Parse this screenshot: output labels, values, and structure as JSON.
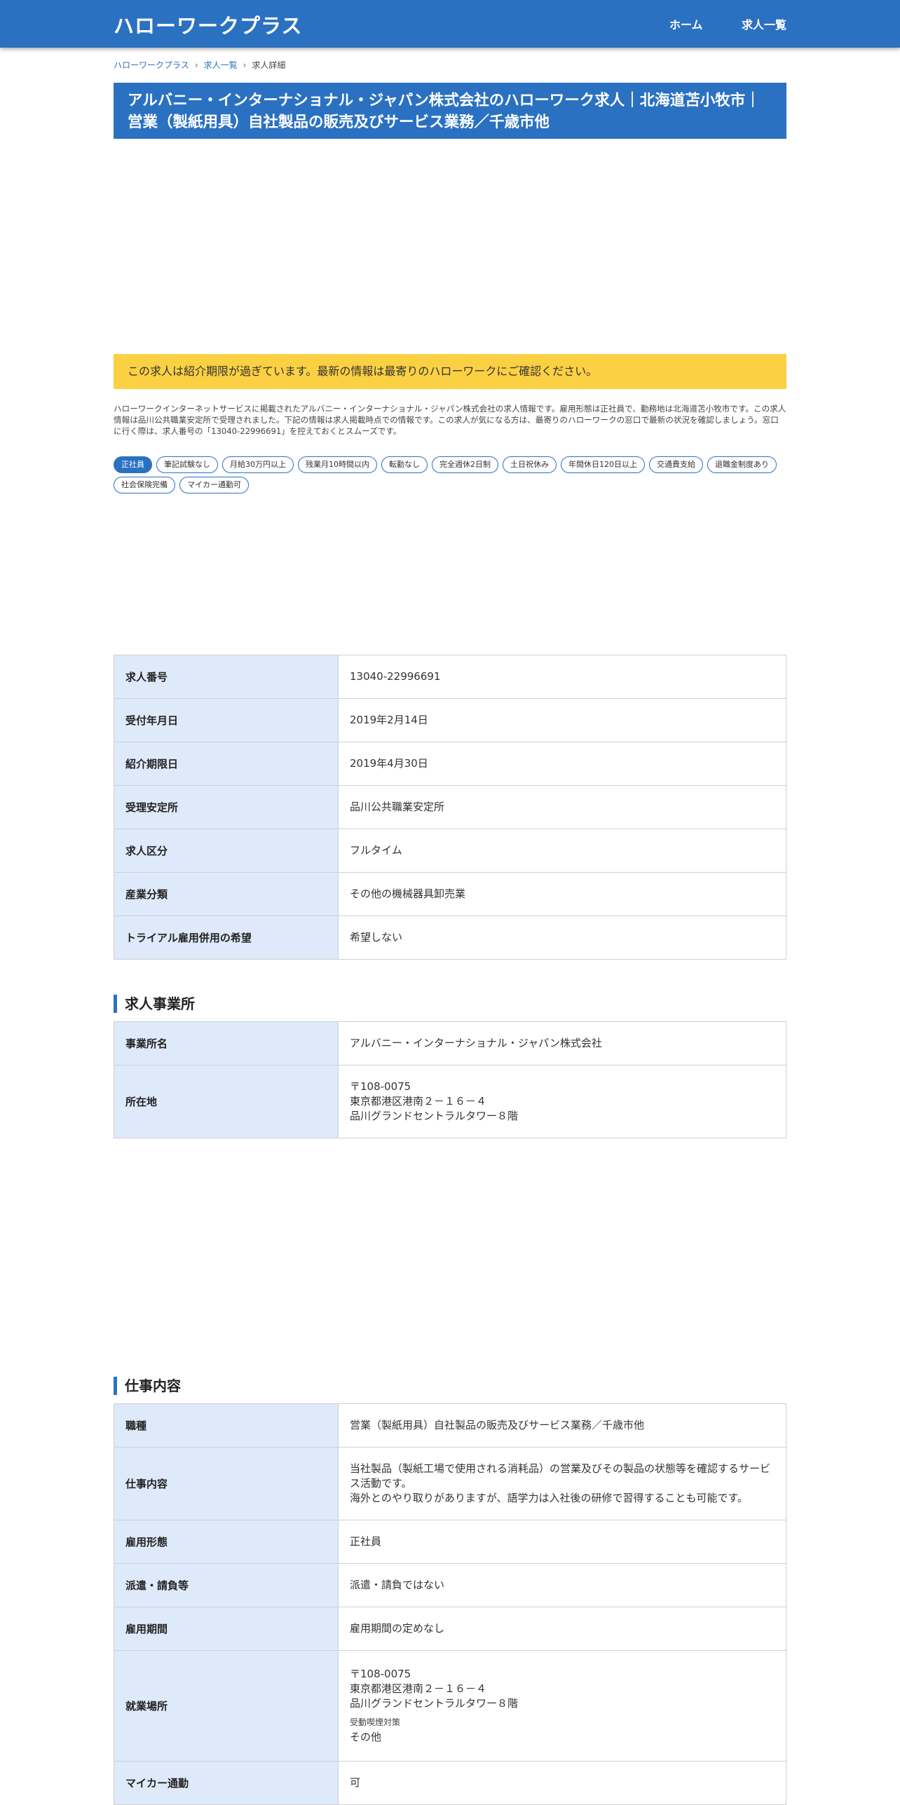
{
  "header": {
    "logo": "ハローワークプラス",
    "nav": [
      "ホーム",
      "求人一覧"
    ]
  },
  "breadcrumb": [
    "ハローワークプラス",
    "求人一覧",
    "求人詳細"
  ],
  "title": "アルバニー・インターナショナル・ジャパン株式会社のハローワーク求人｜北海道苫小牧市｜営業（製紙用具）自社製品の販売及びサービス業務／千歳市他",
  "notice": "この求人は紹介期限が過ぎています。最新の情報は最寄りのハローワークにご確認ください。",
  "description": "ハローワークインターネットサービスに掲載されたアルバニー・インターナショナル・ジャパン株式会社の求人情報です。雇用形態は正社員で、勤務地は北海道苫小牧市です。この求人情報は品川公共職業安定所で受理されました。下記の情報は求人掲載時点での情報です。この求人が気になる方は、最寄りのハローワークの窓口で最新の状況を確認しましょう。窓口に行く際は、求人番号の「13040-22996691」を控えておくとスムーズです。",
  "tags": [
    "正社員",
    "筆記試験なし",
    "月給30万円以上",
    "残業月10時間以内",
    "転勤なし",
    "完全週休2日制",
    "土日祝休み",
    "年間休日120日以上",
    "交通費支給",
    "退職金制度あり",
    "社会保険完備",
    "マイカー通勤可"
  ],
  "basic_table": [
    {
      "label": "求人番号",
      "value": "13040-22996691"
    },
    {
      "label": "受付年月日",
      "value": "2019年2月14日"
    },
    {
      "label": "紹介期限日",
      "value": "2019年4月30日"
    },
    {
      "label": "受理安定所",
      "value": "品川公共職業安定所"
    },
    {
      "label": "求人区分",
      "value": "フルタイム"
    },
    {
      "label": "産業分類",
      "value": "その他の機械器具卸売業"
    },
    {
      "label": "トライアル雇用併用の希望",
      "value": "希望しない"
    }
  ],
  "office_section": {
    "heading": "求人事業所",
    "name_label": "事業所名",
    "name": "アルバニー・インターナショナル・ジャパン株式会社",
    "address_label": "所在地",
    "address": [
      "〒108-0075",
      "東京都港区港南２－１６－４",
      "品川グランドセントラルタワー８階"
    ]
  },
  "job_section": {
    "heading": "仕事内容",
    "type_label": "職種",
    "type": "営業（製紙用具）自社製品の販売及びサービス業務／千歳市他",
    "content_label": "仕事内容",
    "content": [
      "当社製品（製紙工場で使用される消耗品）の営業及びその製品の状態等を確認するサービス活動です。",
      "海外とのやり取りがありますが、語学力は入社後の研修で習得することも可能です。"
    ],
    "employment_label": "雇用形態",
    "employment": "正社員",
    "dispatch_label": "派遣・請負等",
    "dispatch": "派遣・請負ではない",
    "period_label": "雇用期間",
    "period": "雇用期間の定めなし",
    "place_label": "就業場所",
    "place": [
      "〒108-0075",
      "東京都港区港南２－１６－４",
      "品川グランドセントラルタワー８階"
    ],
    "smoking_label": "受動喫煙対策",
    "smoking": "その他",
    "car_label": "マイカー通勤",
    "car": "可"
  }
}
